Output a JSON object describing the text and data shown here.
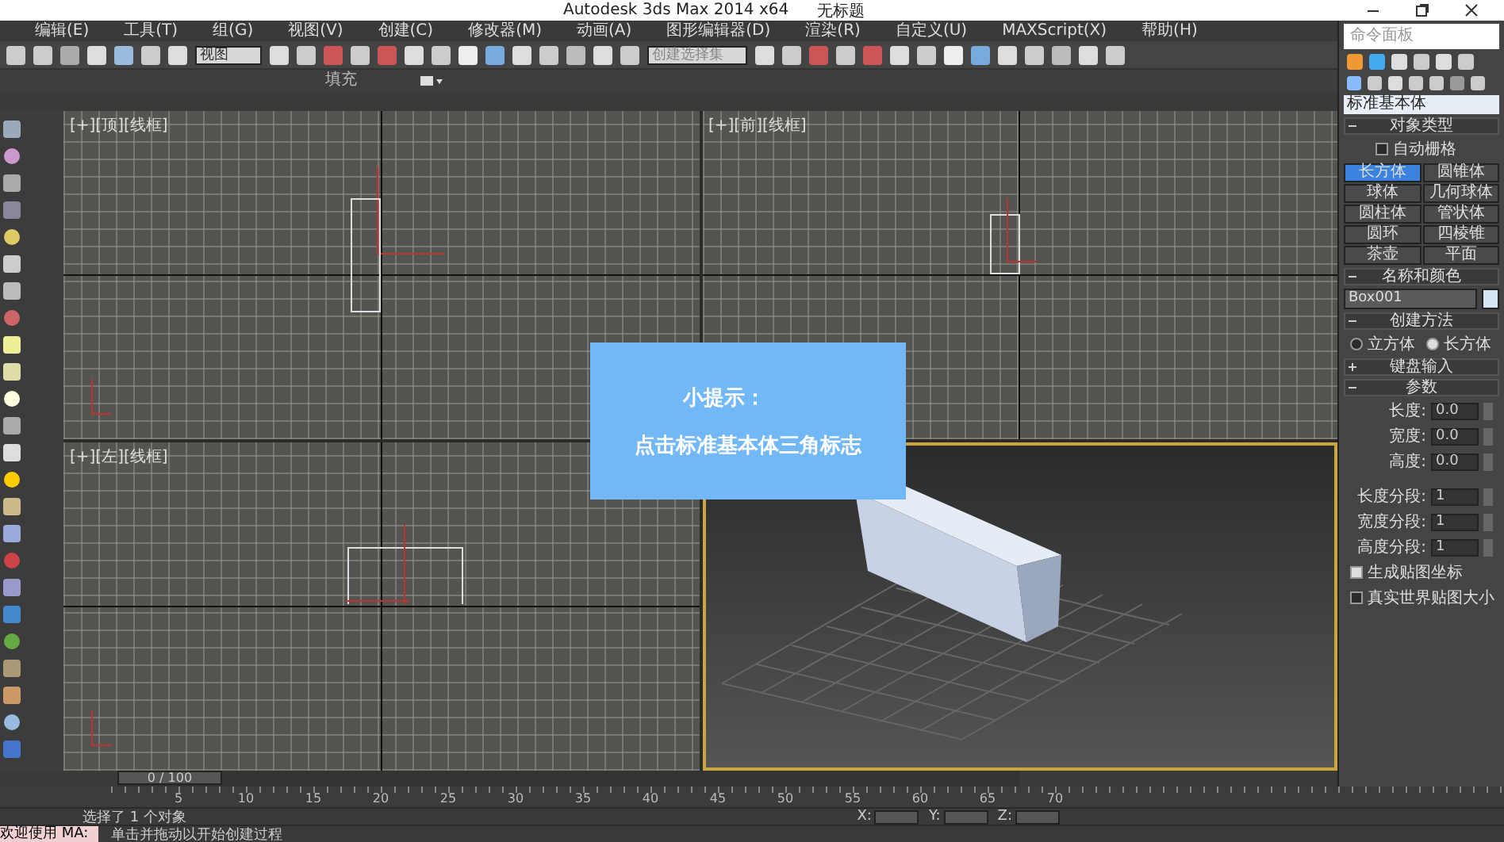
{
  "window": {
    "title": "Autodesk 3ds Max  2014 x64",
    "document": "无标题"
  },
  "menu": [
    "编辑(E)",
    "工具(T)",
    "组(G)",
    "视图(V)",
    "创建(C)",
    "修改器(M)",
    "动画(A)",
    "图形编辑器(D)",
    "渲染(R)",
    "自定义(U)",
    "MAXScript(X)",
    "帮助(H)"
  ],
  "toolbar": {
    "view_dropdown": "视图",
    "selection_set": "创建选择集"
  },
  "ribbon": {
    "tabs": [
      "填充"
    ]
  },
  "viewports": [
    {
      "label": "[+][顶][线框]"
    },
    {
      "label": "[+][前][线框]"
    },
    {
      "label": "[+][左][线框]"
    }
  ],
  "tip": {
    "title": "小提示：",
    "text": "点击标准基本体三角标志"
  },
  "command_panel": {
    "title": "命令面板",
    "category": "标准基本体",
    "object_type": {
      "header": "对象类型",
      "autogrid": {
        "label": "自动栅格",
        "checked": false
      },
      "buttons": [
        {
          "label": "长方体",
          "selected": true
        },
        {
          "label": "圆锥体",
          "selected": false
        },
        {
          "label": "球体",
          "selected": false
        },
        {
          "label": "几何球体",
          "selected": false
        },
        {
          "label": "圆柱体",
          "selected": false
        },
        {
          "label": "管状体",
          "selected": false
        },
        {
          "label": "圆环",
          "selected": false
        },
        {
          "label": "四棱锥",
          "selected": false
        },
        {
          "label": "茶壶",
          "selected": false
        },
        {
          "label": "平面",
          "selected": false
        }
      ]
    },
    "name_color": {
      "header": "名称和颜色",
      "name": "Box001",
      "color": "#d6e4f5"
    },
    "creation": {
      "header": "创建方法",
      "options": [
        {
          "label": "立方体",
          "selected": false
        },
        {
          "label": "长方体",
          "selected": true
        }
      ]
    },
    "keyboard": {
      "header": "键盘输入",
      "expanded": false
    },
    "params": {
      "header": "参数",
      "expanded": true,
      "fields": [
        {
          "label": "长度:",
          "value": "0.0"
        },
        {
          "label": "宽度:",
          "value": "0.0"
        },
        {
          "label": "高度:",
          "value": "0.0"
        }
      ],
      "segments": [
        {
          "label": "长度分段:",
          "value": "1"
        },
        {
          "label": "宽度分段:",
          "value": "1"
        },
        {
          "label": "高度分段:",
          "value": "1"
        }
      ],
      "checks": [
        {
          "label": "生成贴图坐标",
          "checked": true
        },
        {
          "label": "真实世界贴图大小",
          "checked": false
        }
      ]
    }
  },
  "timeline": {
    "frame": "0 / 100",
    "level": 0,
    "ticks": [
      "5",
      "10",
      "15",
      "20",
      "25",
      "30",
      "35",
      "40",
      "45",
      "50",
      "55",
      "60",
      "65",
      "70"
    ]
  },
  "status": {
    "selection": "选择了 1 个对象",
    "prompt": "单击并拖动以开始创建过程",
    "listener": "欢迎使用 MA:",
    "coords": [
      "X:",
      "Y:",
      "Z:"
    ]
  }
}
